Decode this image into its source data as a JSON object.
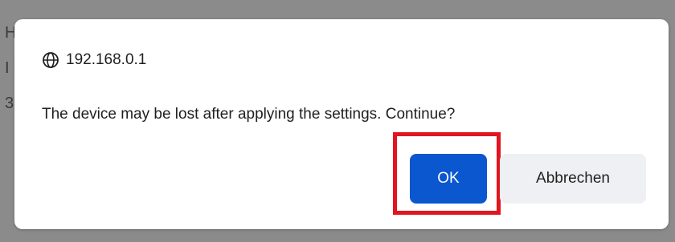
{
  "dialog": {
    "origin": "192.168.0.1",
    "origin_icon": "globe-icon",
    "message": "The device may be lost after applying the settings. Continue?",
    "ok_label": "OK",
    "cancel_label": "Abbrechen"
  },
  "colors": {
    "ok_button_bg": "#0b57d0",
    "highlight_border": "#e1151f",
    "cancel_button_bg": "#eef0f4"
  }
}
